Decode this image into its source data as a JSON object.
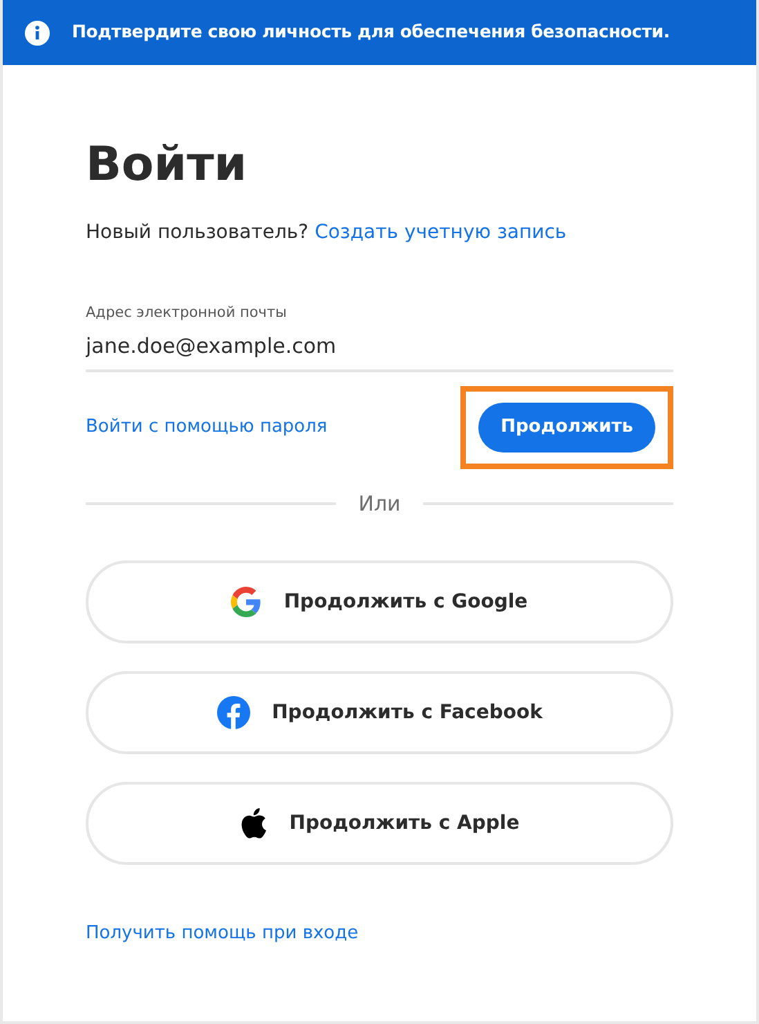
{
  "banner": {
    "text": "Подтвердите свою личность для обеспечения безопасности."
  },
  "title": "Войти",
  "new_user": {
    "text": "Новый пользователь?",
    "link": "Создать учетную запись"
  },
  "email": {
    "label": "Адрес электронной почты",
    "value": "jane.doe@example.com"
  },
  "password_link": "Войти с помощью пароля",
  "continue_button": {
    "label": "Продолжить",
    "highlighted": true
  },
  "divider": "Или",
  "social_buttons": [
    {
      "kind": "google",
      "label": "Продолжить с Google"
    },
    {
      "kind": "facebook",
      "label": "Продолжить с Facebook"
    },
    {
      "kind": "apple",
      "label": "Продолжить с Apple"
    }
  ],
  "help_link": "Получить помощь при входе"
}
